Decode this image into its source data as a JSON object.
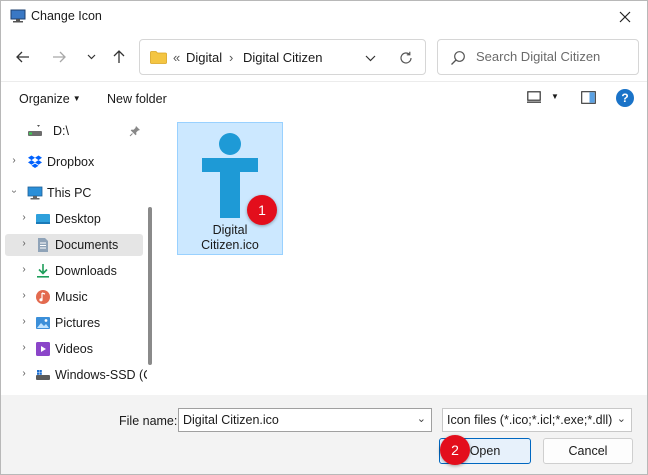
{
  "window": {
    "title": "Change Icon",
    "close_icon": "close-icon"
  },
  "nav": {
    "back_icon": "arrow-left-icon",
    "forward_icon": "arrow-right-icon",
    "recent_icon": "chevron-down-icon",
    "up_icon": "arrow-up-icon",
    "breadcrumb": {
      "overflow": "«",
      "segments": [
        "Digital",
        "Digital Citizen"
      ],
      "separator": "›"
    },
    "search_placeholder": "Search Digital Citizen"
  },
  "commands": {
    "organize": "Organize",
    "new_folder": "New folder",
    "help": "?"
  },
  "sidebar": {
    "items": [
      {
        "label": "D:\\",
        "icon": "drive-icon",
        "pinned": true
      },
      {
        "label": "Dropbox",
        "icon": "dropbox-icon"
      },
      {
        "label": "This PC",
        "icon": "computer-icon",
        "expanded": true
      },
      {
        "label": "Desktop",
        "icon": "desktop-icon"
      },
      {
        "label": "Documents",
        "icon": "documents-icon",
        "selected": true
      },
      {
        "label": "Downloads",
        "icon": "downloads-icon"
      },
      {
        "label": "Music",
        "icon": "music-icon"
      },
      {
        "label": "Pictures",
        "icon": "pictures-icon"
      },
      {
        "label": "Videos",
        "icon": "videos-icon"
      },
      {
        "label": "Windows-SSD (C",
        "icon": "ssd-drive-icon"
      }
    ]
  },
  "files": [
    {
      "name_line1": "Digital",
      "name_line2": "Citizen.ico",
      "icon": "digital-citizen-logo-icon",
      "selected": true
    }
  ],
  "footer": {
    "filename_label": "File name:",
    "filename_value": "Digital Citizen.ico",
    "filetype_value": "Icon files (*.ico;*.icl;*.exe;*.dll)",
    "open_label": "Open",
    "cancel_label": "Cancel"
  },
  "annotations": {
    "badge1": "1",
    "badge2": "2"
  },
  "colors": {
    "accent": "#0067c0",
    "logo": "#1e9ad6",
    "badge": "#e30e1c",
    "selection": "#cce8ff"
  }
}
